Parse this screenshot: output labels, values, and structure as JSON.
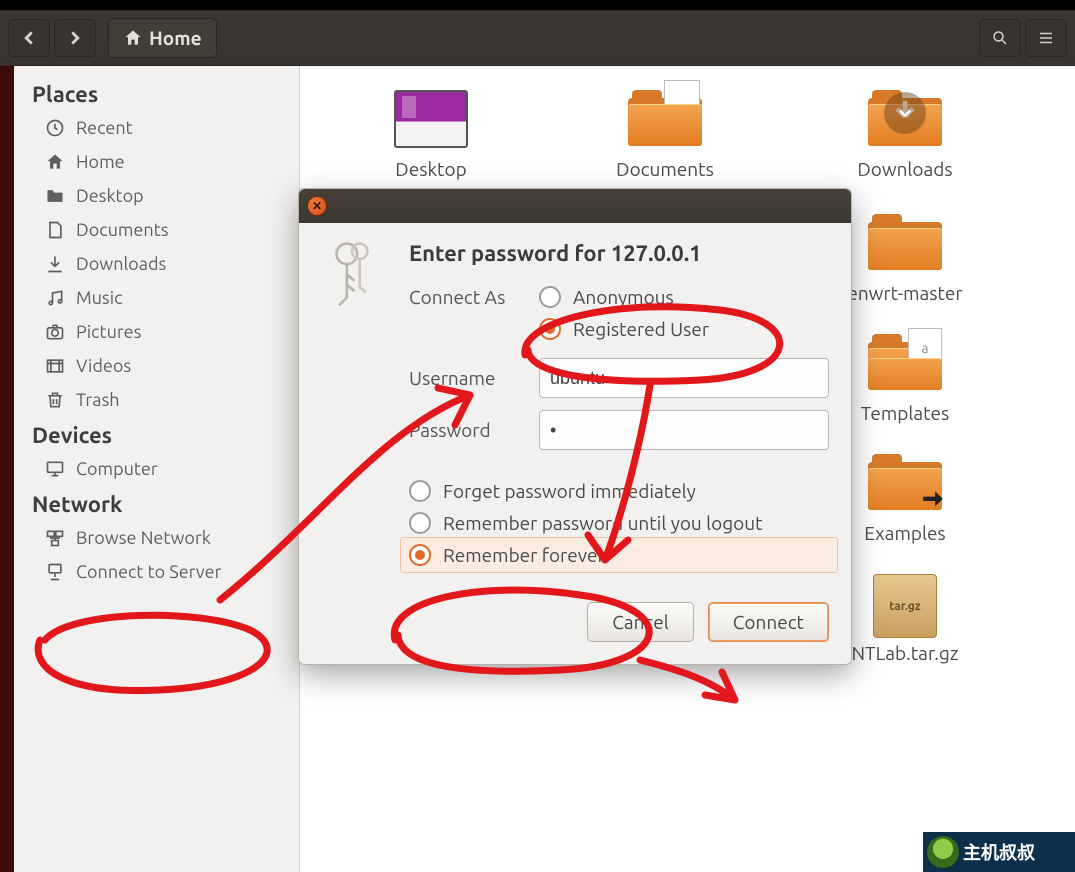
{
  "toolbar": {
    "location": "Home"
  },
  "sidebar": {
    "places_heading": "Places",
    "places": [
      {
        "label": "Recent",
        "icon": "clock-icon"
      },
      {
        "label": "Home",
        "icon": "home-icon"
      },
      {
        "label": "Desktop",
        "icon": "folder-icon"
      },
      {
        "label": "Documents",
        "icon": "document-icon"
      },
      {
        "label": "Downloads",
        "icon": "download-icon"
      },
      {
        "label": "Music",
        "icon": "music-icon"
      },
      {
        "label": "Pictures",
        "icon": "camera-icon"
      },
      {
        "label": "Videos",
        "icon": "video-icon"
      },
      {
        "label": "Trash",
        "icon": "trash-icon"
      }
    ],
    "devices_heading": "Devices",
    "devices": [
      {
        "label": "Computer",
        "icon": "computer-icon"
      }
    ],
    "network_heading": "Network",
    "network": [
      {
        "label": "Browse Network",
        "icon": "network-icon"
      },
      {
        "label": "Connect to Server",
        "icon": "server-icon"
      }
    ]
  },
  "files": [
    {
      "label": "Desktop",
      "kind": "desktop"
    },
    {
      "label": "Documents",
      "kind": "folder-doc"
    },
    {
      "label": "Downloads",
      "kind": "folder-down"
    },
    {
      "label": "enwrt-master",
      "kind": "folder"
    },
    {
      "label": "Templates",
      "kind": "folder-tmpl"
    },
    {
      "label": "Examples",
      "kind": "folder-link"
    },
    {
      "label": "NTLab.tar.gz",
      "kind": "archive",
      "badge": "tar.gz"
    }
  ],
  "dialog": {
    "title": "Enter password for 127.0.0.1",
    "connect_as_label": "Connect As",
    "anon_label": "Anonymous",
    "reg_label": "Registered User",
    "username_label": "Username",
    "username_value": "ubuntu",
    "password_label": "Password",
    "password_value": "•",
    "mem_forget": "Forget password immediately",
    "mem_logout": "Remember password until you logout",
    "mem_forever": "Remember forever",
    "cancel": "Cancel",
    "connect": "Connect"
  },
  "watermark": "主机叔叔"
}
